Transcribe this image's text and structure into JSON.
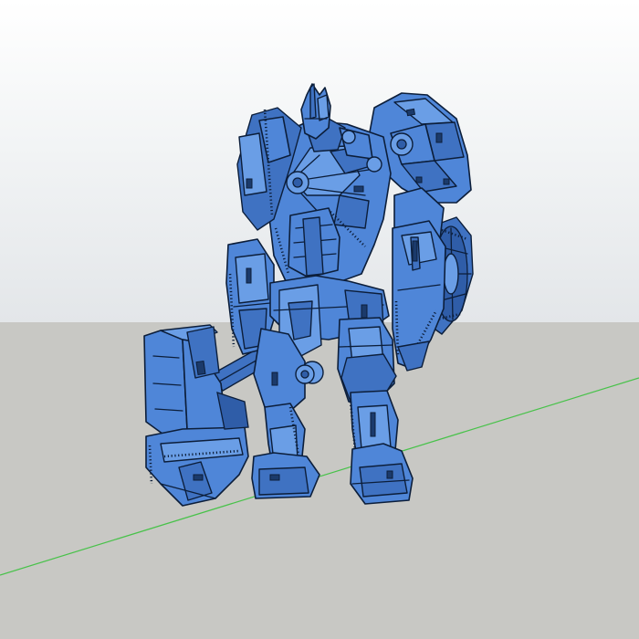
{
  "scene": {
    "sky_top_color": "#ffffff",
    "sky_bottom_color": "#e3e6e9",
    "ground_color": "#c8c8c4",
    "model_color": "#4f86d8",
    "outline_color": "#0c1e3a",
    "axis_color": "#48c24a",
    "model": "robot-mech-with-hammer-and-shield"
  }
}
